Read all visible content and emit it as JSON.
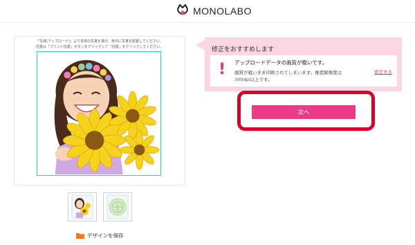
{
  "header": {
    "brand_name": "MONOLABO",
    "logo_icon": "monolabo-logo-icon"
  },
  "editor": {
    "instruction_line_1": "「写真(アップロード)」より本体の写真を選び、枠内に写真を配置してください。",
    "instruction_line_2": "位置は「プリント位置」ボタンをクリックして「位置」をクリックしてください。",
    "photo_description_icon": "photo-girl-with-sunflowers",
    "guide_color": "#29c4e8"
  },
  "thumbnails": [
    {
      "icon": "thumbnail-front-photo"
    },
    {
      "icon": "thumbnail-back-design"
    }
  ],
  "save_design": {
    "label": "デザインを保存",
    "icon": "folder-icon",
    "icon_color": "#f07b1e"
  },
  "recommendation": {
    "title": "修正をおすすめします",
    "warning_icon": "exclamation-icon",
    "warning_title": "アップロードデータの画質が粗いです。",
    "warning_desc_line_1": "画質が粗いまま印刷されてしまいます。推奨解像度は",
    "warning_desc_line_2": "300dpi以上です。",
    "fix_link": "修正する",
    "panel_color": "#fcd6e2",
    "accent_color": "#e53076"
  },
  "next": {
    "label": "次へ",
    "button_color": "#ec3b86",
    "highlight_color": "#d9002a"
  }
}
